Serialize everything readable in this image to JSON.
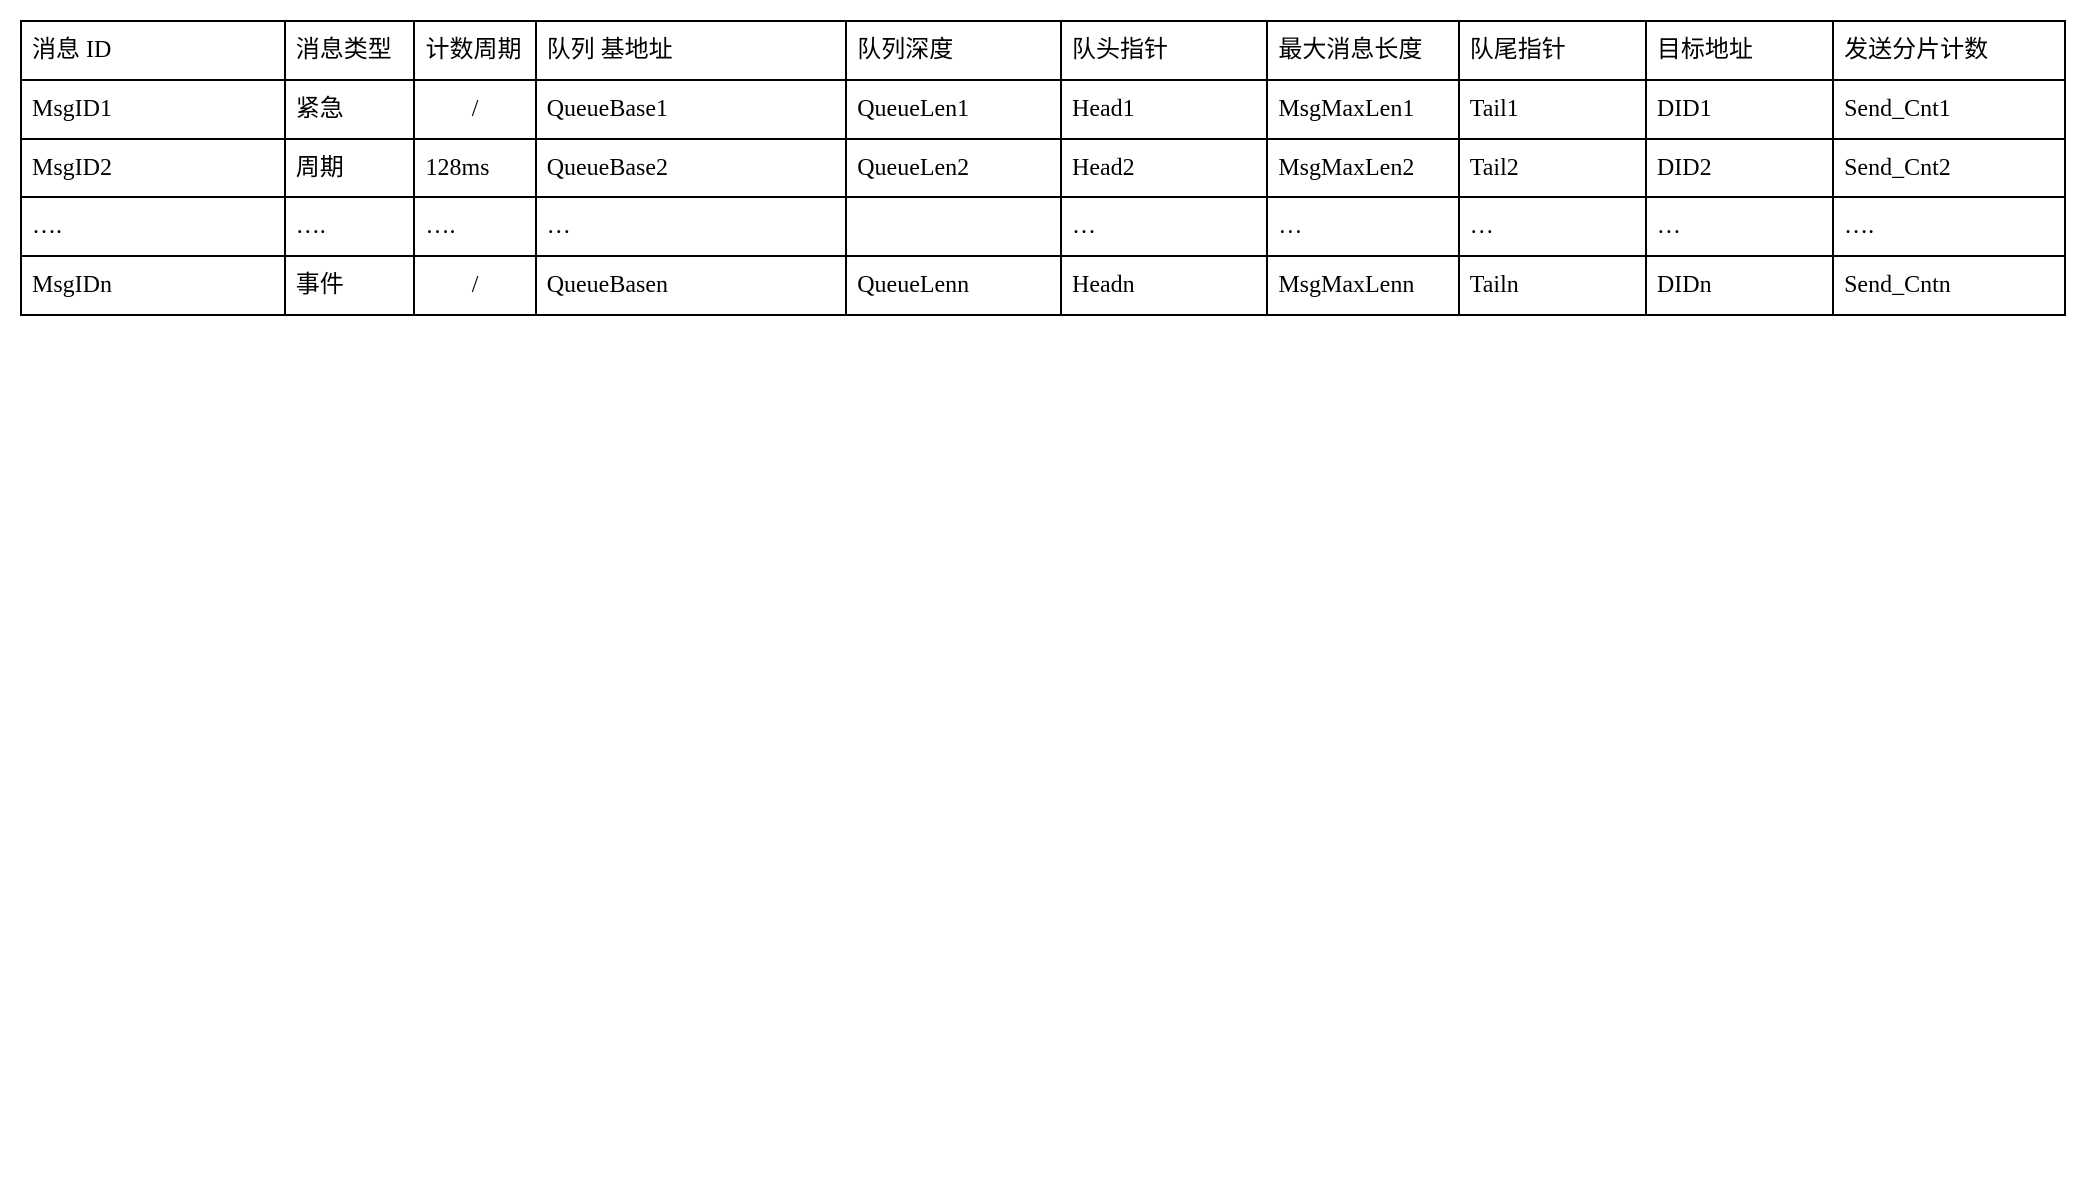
{
  "table": {
    "headers": [
      "消息 ID",
      "消息类型",
      "计数周期",
      "队列\n基地址",
      "队列深度",
      "队头指针",
      "最大消息长度",
      "队尾指针",
      "目标地址",
      "发送分片计数"
    ],
    "rows": [
      {
        "msg_id": "MsgID1",
        "msg_type": "紧急",
        "count_period": "/",
        "queue_base": "QueueBase1",
        "queue_len": "QueueLen1",
        "head": "Head1",
        "msg_max_len": "MsgMaxLen1",
        "tail": "Tail1",
        "did": "DID1",
        "send_cnt": "Send_Cnt1"
      },
      {
        "msg_id": "MsgID2",
        "msg_type": "周期",
        "count_period": "128ms",
        "queue_base": "QueueBase2",
        "queue_len": "QueueLen2",
        "head": "Head2",
        "msg_max_len": "MsgMaxLen2",
        "tail": "Tail2",
        "did": "DID2",
        "send_cnt": "Send_Cnt2"
      },
      {
        "msg_id": "….",
        "msg_type": "….",
        "count_period": "….",
        "queue_base": "…",
        "queue_len": "",
        "head": "…",
        "msg_max_len": "…",
        "tail": "…",
        "did": "…",
        "send_cnt": "…."
      },
      {
        "msg_id": "MsgIDn",
        "msg_type": "事件",
        "count_period": "/",
        "queue_base": "QueueBasen",
        "queue_len": "QueueLenn",
        "head": "Headn",
        "msg_max_len": "MsgMaxLenn",
        "tail": "Tailn",
        "did": "DIDn",
        "send_cnt": "Send_Cntn"
      }
    ]
  }
}
